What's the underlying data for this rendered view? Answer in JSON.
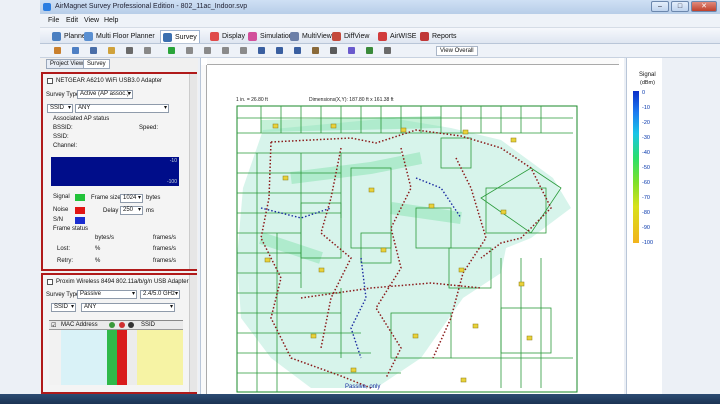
{
  "window": {
    "title": "AirMagnet Survey Professional Edition - 802_11ac_Indoor.svp",
    "controls": {
      "minimize": "–",
      "maximize": "□",
      "close": "✕"
    }
  },
  "menu": [
    "File",
    "Edit",
    "View",
    "Help"
  ],
  "tabs": [
    {
      "label": "Planner",
      "icon": "planner-icon",
      "color": "#4a7fc1"
    },
    {
      "label": "Multi Floor Planner",
      "icon": "multi-floor-icon",
      "color": "#5a8fd1"
    },
    {
      "label": "Survey",
      "icon": "survey-icon",
      "color": "#3b6fb0",
      "active": true
    },
    {
      "label": "Display",
      "icon": "display-icon",
      "color": "#e04b4b"
    },
    {
      "label": "Simulation",
      "icon": "simulation-icon",
      "color": "#d24f9b"
    },
    {
      "label": "MultiView",
      "icon": "multiview-icon",
      "color": "#6b7fa8"
    },
    {
      "label": "DiffView",
      "icon": "diffview-icon",
      "color": "#c44a3c"
    },
    {
      "label": "AirWISE",
      "icon": "airwise-icon",
      "color": "#d13b3b"
    },
    {
      "label": "Reports",
      "icon": "reports-icon",
      "color": "#c03737"
    }
  ],
  "toolbar": {
    "view_dropdown": "View Overall",
    "buttons": [
      {
        "name": "pointer-icon",
        "color": "#c9802e"
      },
      {
        "name": "new-file-icon",
        "color": "#4d7fc4"
      },
      {
        "name": "save-icon",
        "color": "#4a6ea8"
      },
      {
        "name": "open-icon",
        "color": "#d0a23c"
      },
      {
        "name": "print-icon",
        "color": "#6a6a6a"
      },
      {
        "name": "undo-icon",
        "color": "#888888"
      },
      {
        "name": "play-icon",
        "color": "#2aa43a"
      },
      {
        "name": "stop-icon",
        "color": "#8a8a8a"
      },
      {
        "name": "record-icon",
        "color": "#8a8a8a"
      },
      {
        "name": "pause-icon",
        "color": "#8a8a8a"
      },
      {
        "name": "loop-icon",
        "color": "#8a8a8a"
      },
      {
        "name": "zoom-in-icon",
        "color": "#3a5fa0"
      },
      {
        "name": "zoom-out-icon",
        "color": "#3a5fa0"
      },
      {
        "name": "zoom-fit-icon",
        "color": "#3a5fa0"
      },
      {
        "name": "hand-icon",
        "color": "#8a6a3a"
      },
      {
        "name": "grid-icon",
        "color": "#5a5a5a"
      },
      {
        "name": "ap-icon",
        "color": "#6a5acd"
      },
      {
        "name": "measure-icon",
        "color": "#3a8a3a"
      },
      {
        "name": "layers-icon",
        "color": "#6a6a6a"
      }
    ]
  },
  "left_tabs": [
    "Project View",
    "Survey"
  ],
  "adapter1": {
    "name": "NETGEAR A6210 WiFi USB3.0 Adapter",
    "survey_type_label": "Survey Type",
    "survey_type": "Active (AP assoc.)",
    "ssid_label": "SSID",
    "ssid_value": "ANY",
    "status_heading": "Associated AP status",
    "bssid_label": "BSSID:",
    "speed_label": "Speed:",
    "ssid_field_label": "SSID:",
    "channel_label": "Channel:",
    "graph_top": "-10",
    "graph_bottom": "-100",
    "signal_label": "Signal",
    "noise_label": "Noise",
    "sn_label": "S/N",
    "frame_size_label": "Frame size",
    "frame_size_value": "1024",
    "frame_size_unit": "bytes",
    "delay_label": "Delay",
    "delay_value": "250",
    "delay_unit": "ms",
    "frame_status_label": "Frame status",
    "bytes_col": "bytes/s",
    "frames_col": "frames/s",
    "lost_label": "Lost:",
    "retry_label": "Retry:",
    "lost_pct": "%",
    "retry_pct": "%",
    "signal_color": "#22c33a",
    "noise_color": "#e01515",
    "sn_color": "#1b2ed0"
  },
  "adapter2": {
    "name": "Proxim Wireless 8494 802.11a/b/g/n USB Adapter #",
    "survey_type_label": "Survey Type",
    "survey_type": "Passive",
    "band": "2.4/5.0 GHz",
    "ssid_label": "SSID",
    "ssid_value": "ANY",
    "columns": [
      "MAC Address",
      "SSID"
    ]
  },
  "map": {
    "scale_text": "1 in. = 26.80 ft",
    "dimensions_text": "Dimensions(X,Y): 187.80 ft x 161.38 ft",
    "overlay_text": "Passive, only"
  },
  "legend": {
    "title": "Signal",
    "unit": "(dBm)",
    "ticks": [
      "0",
      "-10",
      "-20",
      "-30",
      "-40",
      "-50",
      "-60",
      "-70",
      "-80",
      "-90",
      "-100"
    ]
  }
}
